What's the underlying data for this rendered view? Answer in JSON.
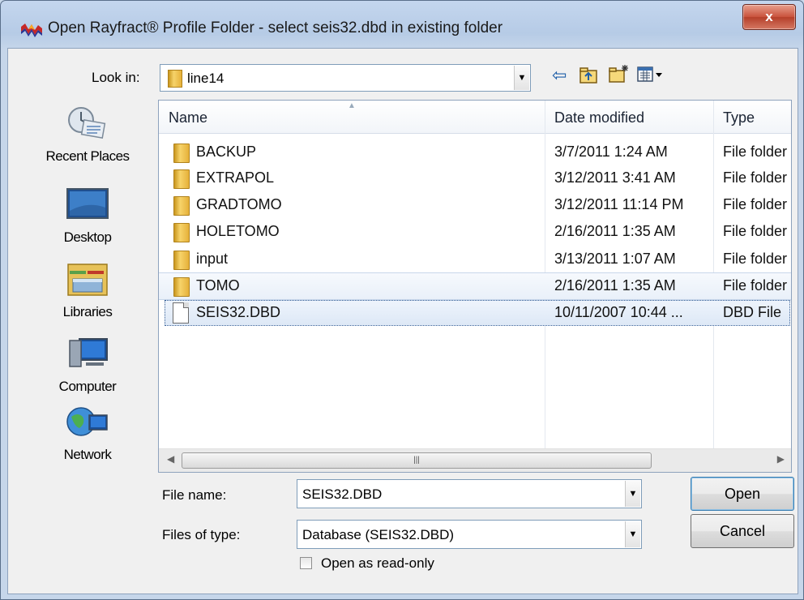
{
  "window": {
    "title": "Open Rayfract® Profile Folder - select seis32.dbd in existing folder",
    "close_label": "x"
  },
  "toolbar": {
    "look_in_label": "Look in:",
    "look_in_value": "line14",
    "icons": [
      "back-arrow-icon",
      "up-folder-icon",
      "new-folder-icon",
      "view-menu-icon"
    ]
  },
  "places": [
    {
      "label": "Recent Places",
      "icon": "recent-places-icon"
    },
    {
      "label": "Desktop",
      "icon": "desktop-icon"
    },
    {
      "label": "Libraries",
      "icon": "libraries-icon"
    },
    {
      "label": "Computer",
      "icon": "computer-icon"
    },
    {
      "label": "Network",
      "icon": "network-icon"
    }
  ],
  "columns": [
    "Name",
    "Date modified",
    "Type"
  ],
  "files": [
    {
      "name": "BACKUP",
      "date": "3/7/2011 1:24 AM",
      "type": "File folder",
      "kind": "folder"
    },
    {
      "name": "EXTRAPOL",
      "date": "3/12/2011 3:41 AM",
      "type": "File folder",
      "kind": "folder"
    },
    {
      "name": "GRADTOMO",
      "date": "3/12/2011 11:14 PM",
      "type": "File folder",
      "kind": "folder"
    },
    {
      "name": "HOLETOMO",
      "date": "2/16/2011 1:35 AM",
      "type": "File folder",
      "kind": "folder"
    },
    {
      "name": "input",
      "date": "3/13/2011 1:07 AM",
      "type": "File folder",
      "kind": "folder"
    },
    {
      "name": "TOMO",
      "date": "2/16/2011 1:35 AM",
      "type": "File folder",
      "kind": "folder"
    },
    {
      "name": "SEIS32.DBD",
      "date": "10/11/2007 10:44 ...",
      "type": "DBD File",
      "kind": "file"
    }
  ],
  "form": {
    "file_name_label": "File name:",
    "file_name_value": "SEIS32.DBD",
    "file_type_label": "Files of type:",
    "file_type_value": "Database (SEIS32.DBD)",
    "read_only_label": "Open as read-only",
    "read_only_checked": false
  },
  "buttons": {
    "open": "Open",
    "cancel": "Cancel"
  },
  "colors": {
    "selection_border": "#355e95",
    "title_bar": "#b6cbe6",
    "close_button": "#c9523c"
  }
}
